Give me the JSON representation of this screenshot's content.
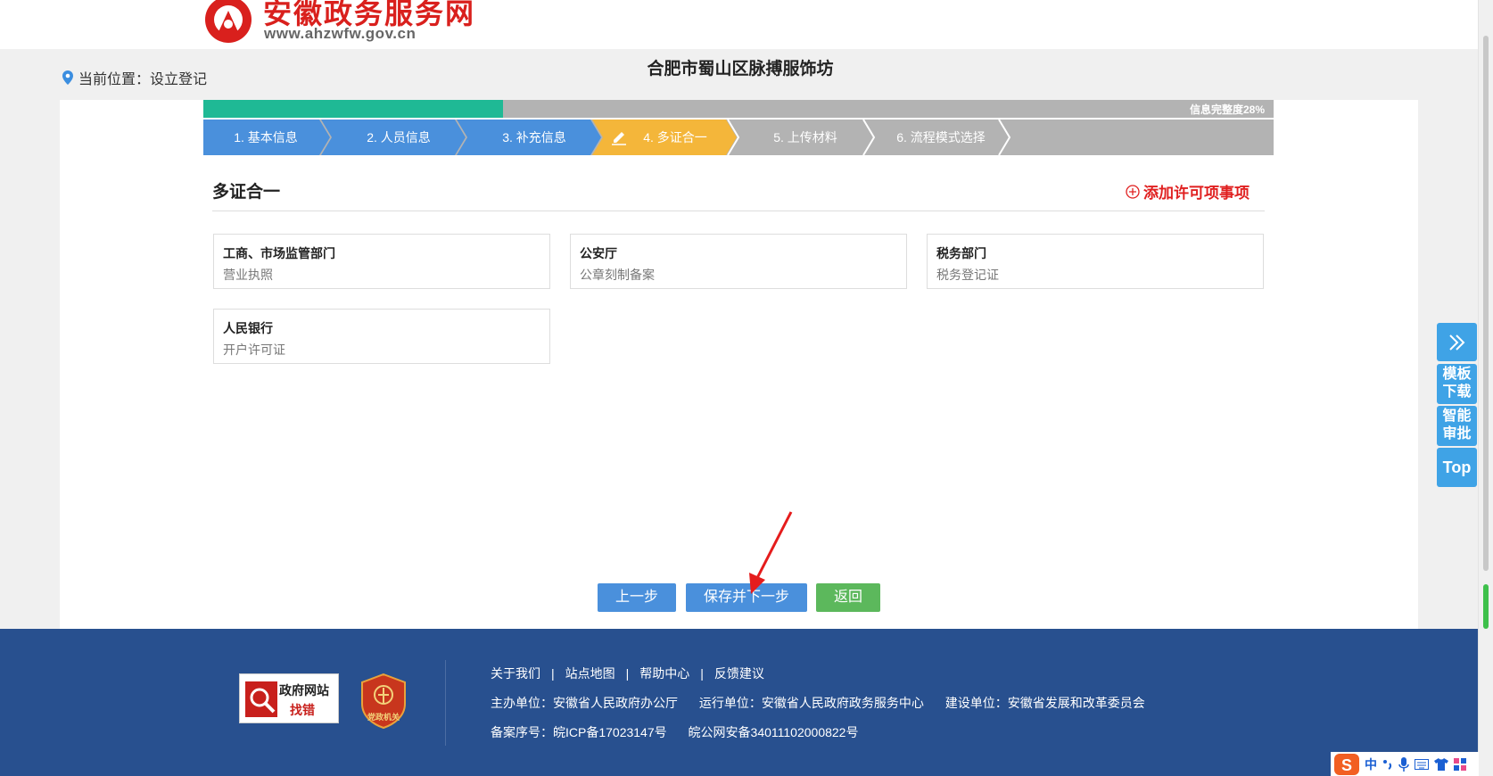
{
  "header": {
    "logo_title": "安徽政务服务网",
    "logo_url": "www.ahzwfw.gov.cn",
    "brand_color": "#d9201d"
  },
  "location": {
    "label": "当前位置：设立登记",
    "icon": "location-pin-icon"
  },
  "page_title": "合肥市蜀山区脉搏服饰坊",
  "progress": {
    "label": "信息完整度28%",
    "percent": 28,
    "fill_color": "#1fb995"
  },
  "steps": [
    {
      "label": "1. 基本信息",
      "state": "done"
    },
    {
      "label": "2. 人员信息",
      "state": "done"
    },
    {
      "label": "3. 补充信息",
      "state": "done"
    },
    {
      "label": "4. 多证合一",
      "state": "active"
    },
    {
      "label": "5. 上传材料",
      "state": "pending"
    },
    {
      "label": "6. 流程模式选择",
      "state": "pending"
    }
  ],
  "section": {
    "title": "多证合一",
    "add_label": "添加许可项事项"
  },
  "cards": [
    {
      "title": "工商、市场监管部门",
      "sub": "营业执照"
    },
    {
      "title": "公安厅",
      "sub": "公章刻制备案"
    },
    {
      "title": "税务部门",
      "sub": "税务登记证"
    },
    {
      "title": "人民银行",
      "sub": "开户许可证"
    }
  ],
  "buttons": {
    "prev": "上一步",
    "save_next": "保存并下一步",
    "back": "返回"
  },
  "side_widgets": {
    "template_download": "模板下载",
    "smart_approval": "智能审批",
    "top": "Top"
  },
  "footer": {
    "jiucuo_line1": "政府网站",
    "jiucuo_line2": "找错",
    "badge_text": "党政机关",
    "links": [
      "关于我们",
      "站点地图",
      "帮助中心",
      "反馈建议"
    ],
    "host": "主办单位：安徽省人民政府办公厅",
    "operator": "运行单位：安徽省人民政府政务服务中心",
    "builder": "建设单位：安徽省发展和改革委员会",
    "icp": "备案序号：皖ICP备17023147号",
    "police": "皖公网安备34011102000822号"
  },
  "ime": {
    "lang": "中"
  },
  "colors": {
    "step_done": "#4a90dc",
    "step_active": "#f4b63a",
    "step_pending": "#b3b3b3",
    "footer_bg": "#28508f",
    "button_blue": "#4a90dc",
    "button_green": "#5cb85c"
  }
}
